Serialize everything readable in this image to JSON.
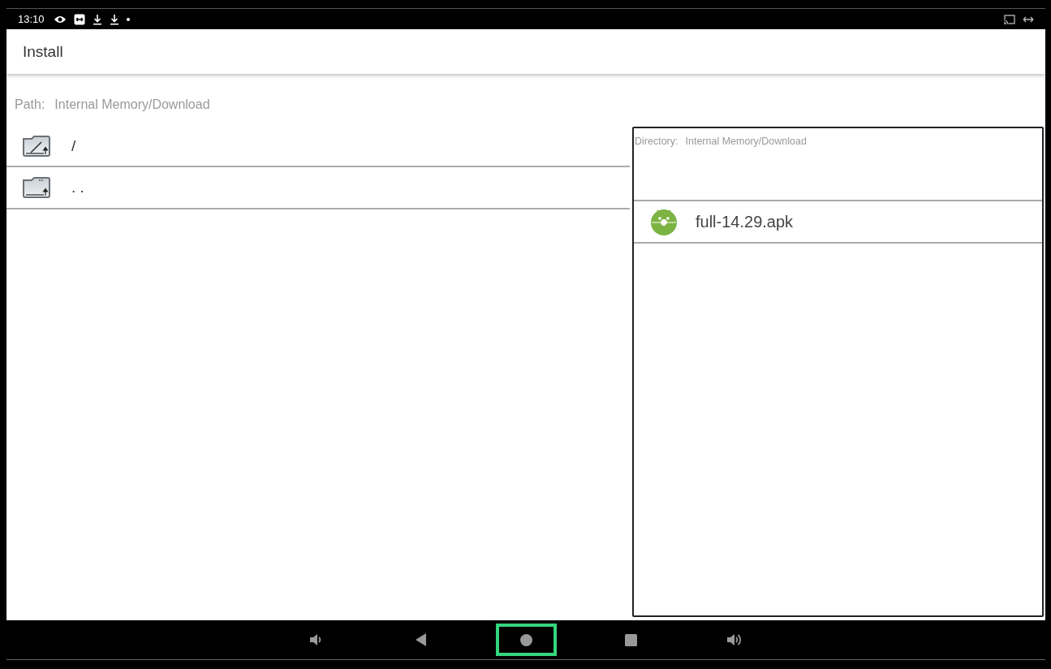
{
  "status_bar": {
    "time": "13:10",
    "left_icons": [
      {
        "kind": "eye"
      },
      {
        "kind": "remote"
      },
      {
        "kind": "download"
      },
      {
        "kind": "download"
      },
      {
        "kind": "dot"
      }
    ],
    "right_icons": [
      {
        "kind": "cast"
      },
      {
        "kind": "arrows"
      }
    ]
  },
  "app_bar": {
    "title": "Install"
  },
  "path": {
    "label": "Path:",
    "value": "Internal Memory/Download"
  },
  "folder_list": [
    {
      "kind": "root",
      "name": "/"
    },
    {
      "kind": "parent",
      "name": ". ."
    }
  ],
  "directory_panel": {
    "label": "Directory:",
    "value": "Internal Memory/Download",
    "files": [
      {
        "kind": "apk",
        "name": "full-14.29.apk"
      }
    ]
  },
  "nav_bar": [
    {
      "kind": "volume-down",
      "highlighted": false
    },
    {
      "kind": "back",
      "highlighted": false
    },
    {
      "kind": "home",
      "highlighted": true
    },
    {
      "kind": "recents",
      "highlighted": false
    },
    {
      "kind": "volume-up",
      "highlighted": false
    }
  ]
}
